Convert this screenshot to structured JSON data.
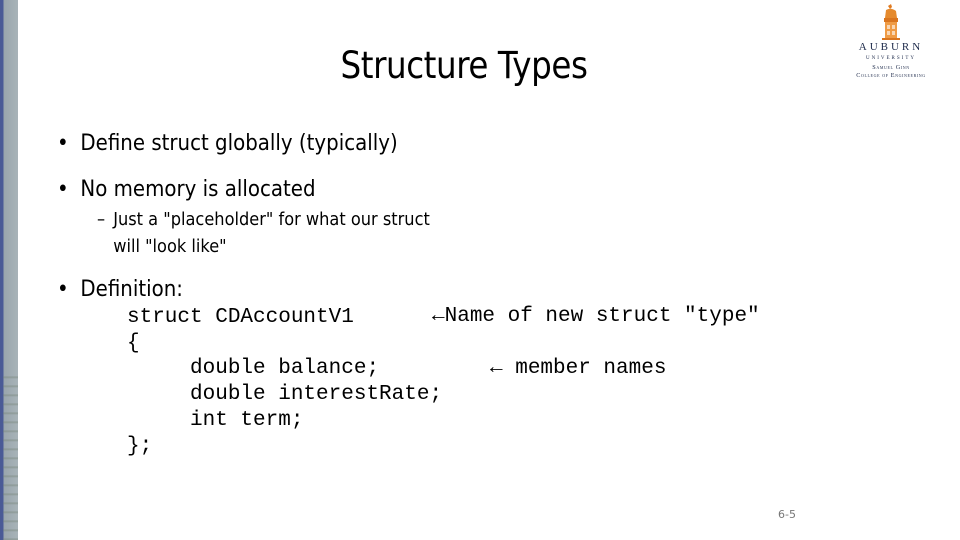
{
  "slide": {
    "title": "Structure Types",
    "logo": {
      "name": "AUBURN",
      "subtitle": "UNIVERSITY",
      "college_line1": "Samuel Ginn",
      "college_line2": "College of Engineering"
    },
    "bullets": [
      {
        "text": "Define struct globally (typically)"
      },
      {
        "text": "No memory is allocated",
        "sub": [
          "Just a \"placeholder\" for what our struct",
          "will \"look like\""
        ]
      },
      {
        "text": "Definition:"
      }
    ],
    "bullet_glyph": "•",
    "dash_glyph": "–",
    "code_lines": [
      "struct CDAccountV1",
      "{",
      "     double balance;",
      "     double interestRate;",
      "     int term;",
      "};"
    ],
    "annotations": [
      {
        "arrow": "←",
        "text": "Name of new struct \"type\""
      },
      {
        "arrow": "←",
        "text": " member names"
      }
    ],
    "page_number": "6-5"
  }
}
